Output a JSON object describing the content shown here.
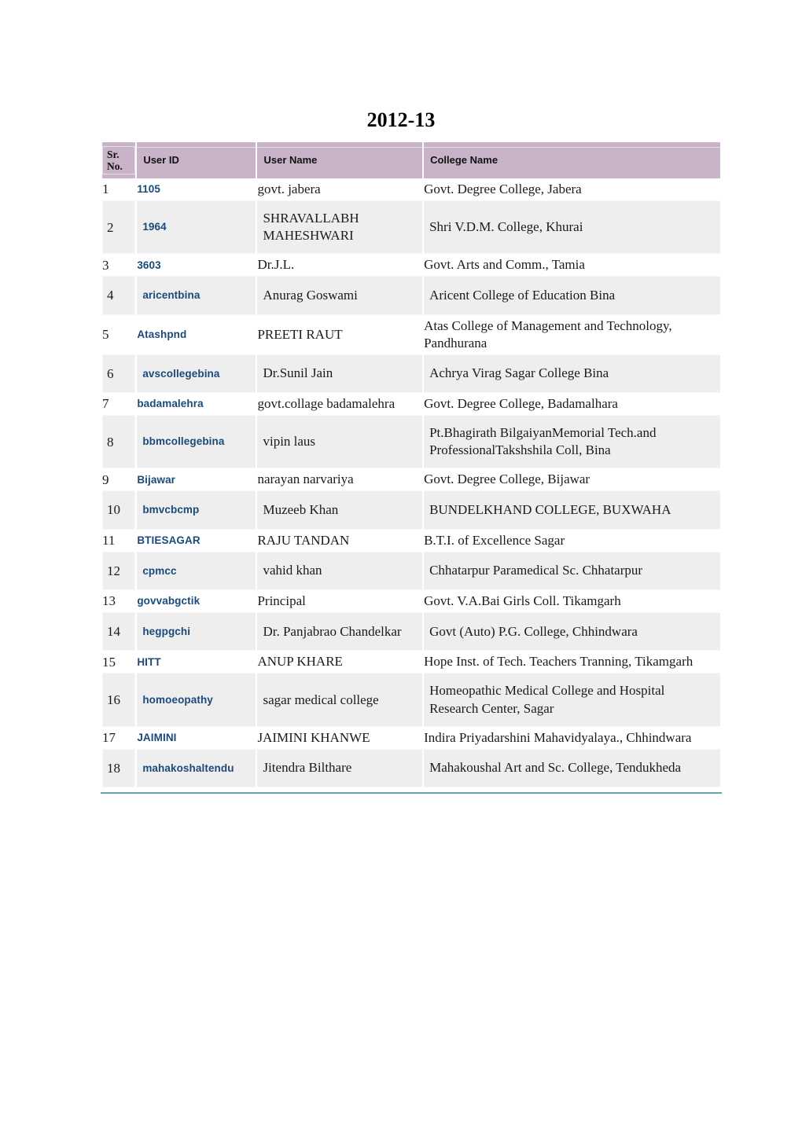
{
  "document": {
    "title": "2012-13"
  },
  "table": {
    "columns": [
      {
        "key": "sr_no",
        "label": "Sr.\nNo.",
        "label_line1": "Sr.",
        "label_line2": "No."
      },
      {
        "key": "user_id",
        "label": "User ID"
      },
      {
        "key": "user_name",
        "label": "User Name"
      },
      {
        "key": "college_name",
        "label": "College Name"
      }
    ],
    "rows": [
      {
        "sr_no": "1",
        "user_id": "1105",
        "user_name": "govt. jabera",
        "college_name": "Govt. Degree College, Jabera"
      },
      {
        "sr_no": "2",
        "user_id": "1964",
        "user_name": "SHRAVALLABH MAHESHWARI",
        "college_name": "Shri V.D.M. College, Khurai"
      },
      {
        "sr_no": "3",
        "user_id": "3603",
        "user_name": "Dr.J.L.",
        "college_name": "Govt. Arts and Comm., Tamia"
      },
      {
        "sr_no": "4",
        "user_id": "aricentbina",
        "user_name": "Anurag Goswami",
        "college_name": "Aricent College of Education Bina"
      },
      {
        "sr_no": "5",
        "user_id": "Atashpnd",
        "user_name": "PREETI RAUT",
        "college_name": "Atas College of Management and Technology, Pandhurana"
      },
      {
        "sr_no": "6",
        "user_id": "avscollegebina",
        "user_name": "Dr.Sunil Jain",
        "college_name": "Achrya Virag Sagar College Bina"
      },
      {
        "sr_no": "7",
        "user_id": "badamalehra",
        "user_name": "govt.collage badamalehra",
        "college_name": "Govt. Degree College, Badamalhara"
      },
      {
        "sr_no": "8",
        "user_id": "bbmcollegebina",
        "user_name": "vipin laus",
        "college_name": "Pt.Bhagirath BilgaiyanMemorial Tech.and ProfessionalTakshshila Coll, Bina"
      },
      {
        "sr_no": "9",
        "user_id": "Bijawar",
        "user_name": "narayan narvariya",
        "college_name": "Govt. Degree College, Bijawar"
      },
      {
        "sr_no": "10",
        "user_id": "bmvcbcmp",
        "user_name": "Muzeeb Khan",
        "college_name": "BUNDELKHAND COLLEGE, BUXWAHA"
      },
      {
        "sr_no": "11",
        "user_id": "BTIESAGAR",
        "user_name": "RAJU TANDAN",
        "college_name": "B.T.I. of Excellence Sagar"
      },
      {
        "sr_no": "12",
        "user_id": "cpmcc",
        "user_name": "vahid khan",
        "college_name": "Chhatarpur Paramedical Sc. Chhatarpur"
      },
      {
        "sr_no": "13",
        "user_id": "govvabgctik",
        "user_name": "Principal",
        "college_name": "Govt. V.A.Bai Girls Coll. Tikamgarh"
      },
      {
        "sr_no": "14",
        "user_id": "hegpgchi",
        "user_name": "Dr. Panjabrao Chandelkar",
        "college_name": "Govt (Auto) P.G. College, Chhindwara"
      },
      {
        "sr_no": "15",
        "user_id": "HITT",
        "user_name": "ANUP KHARE",
        "college_name": "Hope Inst. of Tech. Teachers Tranning, Tikamgarh"
      },
      {
        "sr_no": "16",
        "user_id": "homoeopathy",
        "user_name": "sagar medical college",
        "college_name": "Homeopathic Medical College and Hospital Research Center, Sagar"
      },
      {
        "sr_no": "17",
        "user_id": "JAIMINI",
        "user_name": "JAIMINI KHANWE",
        "college_name": "Indira Priyadarshini Mahavidyalaya., Chhindwara"
      },
      {
        "sr_no": "18",
        "user_id": "mahakoshaltendu",
        "user_name": "Jitendra Bilthare",
        "college_name": "Mahakoushal Art and Sc. College, Tendukheda"
      }
    ]
  },
  "style": {
    "header_background": "#c9b3c9",
    "alt_row_background": "#eeeeee",
    "user_id_color": "#1b4a7a",
    "bottom_rule_color": "#68a5ad",
    "text_color": "#1a1a1a"
  }
}
